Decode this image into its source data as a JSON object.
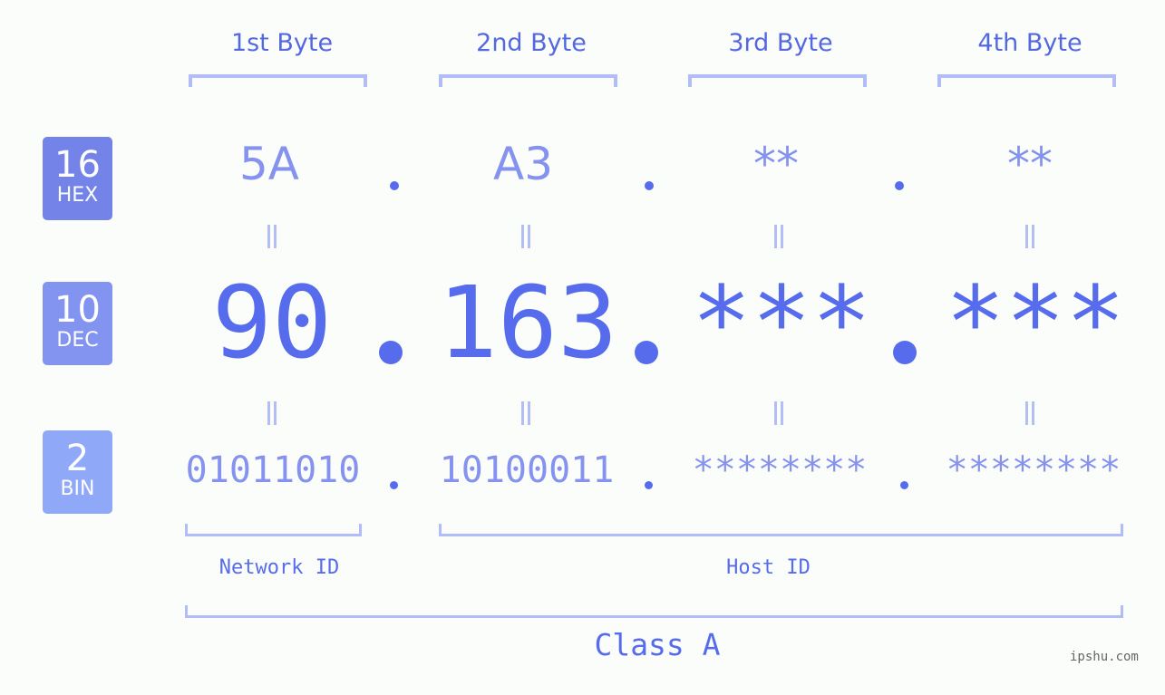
{
  "rows": {
    "hex": {
      "base": "16",
      "label": "HEX"
    },
    "dec": {
      "base": "10",
      "label": "DEC"
    },
    "bin": {
      "base": "2",
      "label": "BIN"
    }
  },
  "bytes": [
    {
      "title": "1st Byte",
      "hex": "5A",
      "dec": "90",
      "bin": "01011010"
    },
    {
      "title": "2nd Byte",
      "hex": "A3",
      "dec": "163",
      "bin": "10100011"
    },
    {
      "title": "3rd Byte",
      "hex": "**",
      "dec": "***",
      "bin": "********"
    },
    {
      "title": "4th Byte",
      "hex": "**",
      "dec": "***",
      "bin": "********"
    }
  ],
  "labels": {
    "network_id": "Network ID",
    "host_id": "Host ID",
    "class": "Class A"
  },
  "watermark": "ipshu.com",
  "colors": {
    "accent": "#566ced",
    "light_accent": "#8693ee",
    "bracket": "#b2bcf6",
    "hex_badge": "#7383e8",
    "dec_badge": "#8393f0",
    "bin_badge": "#90a8f8"
  }
}
